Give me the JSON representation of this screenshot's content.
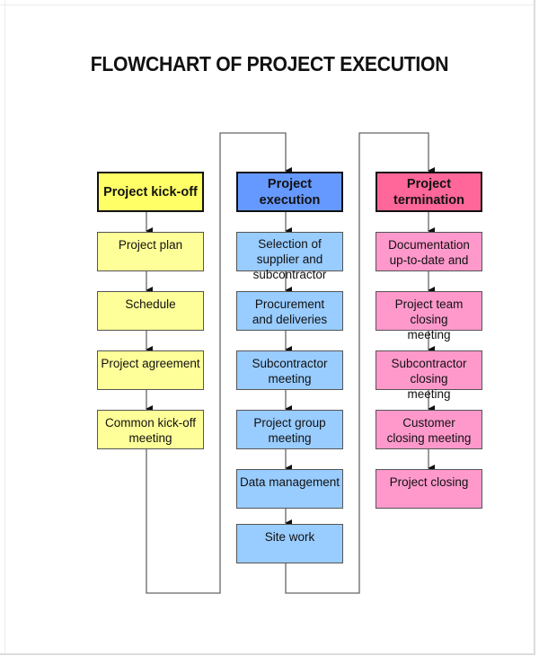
{
  "title": "FLOWCHART OF PROJECT EXECUTION",
  "colors": {
    "kickoff_header": "#ffff66",
    "kickoff_step": "#ffff99",
    "execution_header": "#6699ff",
    "execution_step": "#99ccff",
    "termination_header": "#ff6699",
    "termination_step": "#ff99cc",
    "connector": "#666666"
  },
  "columns": [
    {
      "header": "Project kick-off",
      "steps": [
        "Project plan",
        "Schedule",
        "Project agreement",
        "Common kick-off meeting"
      ]
    },
    {
      "header": "Project execution",
      "steps": [
        "Selection of supplier and subcontractor",
        "Procurement and deliveries",
        "Subcontractor meeting",
        "Project group meeting",
        "Data management",
        "Site work"
      ]
    },
    {
      "header": "Project termination",
      "steps": [
        "Documentation up-to-date and",
        "Project team closing meeting",
        "Subcontractor closing meeting",
        "Customer closing meeting",
        "Project closing"
      ]
    }
  ]
}
